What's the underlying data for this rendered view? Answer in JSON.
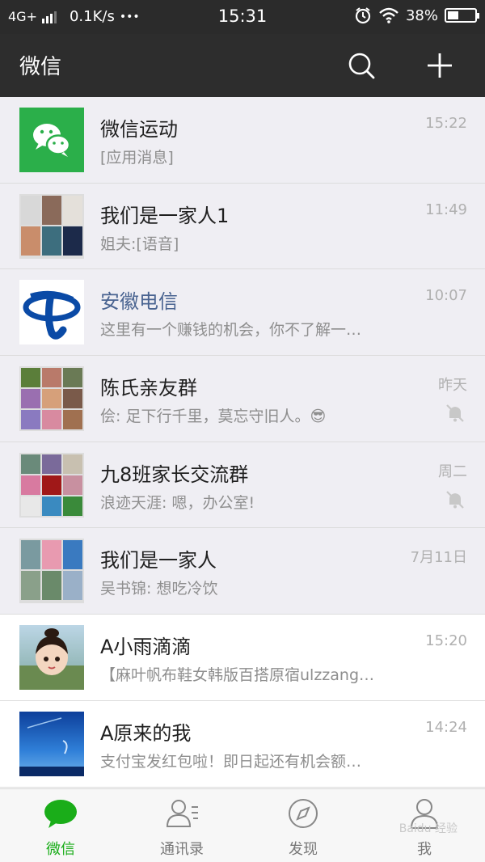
{
  "status_bar": {
    "network": "4G+",
    "speed": "0.1K/s",
    "more": "•••",
    "time": "15:31",
    "battery": "38%"
  },
  "header": {
    "title": "微信",
    "search_icon": "search-icon",
    "add_icon": "plus-icon"
  },
  "chats": [
    {
      "name": "微信运动",
      "message": "[应用消息]",
      "time": "15:22",
      "pinned": true,
      "muted": false,
      "avatar": "wechat-sport"
    },
    {
      "name": "我们是一家人1",
      "message": "姐夫:[语音]",
      "time": "11:49",
      "pinned": true,
      "muted": false,
      "avatar": "group"
    },
    {
      "name": "安徽电信",
      "message": "这里有一个赚钱的机会，你不了解一…",
      "time": "10:07",
      "pinned": true,
      "muted": false,
      "avatar": "telecom"
    },
    {
      "name": "陈氏亲友群",
      "message": "侩: 足下行千里，莫忘守旧人。😎",
      "time": "昨天",
      "pinned": true,
      "muted": true,
      "avatar": "group"
    },
    {
      "name": "九8班家长交流群",
      "message": "浪迹天涯: 嗯，办公室!",
      "time": "周二",
      "pinned": true,
      "muted": true,
      "avatar": "group"
    },
    {
      "name": "我们是一家人",
      "message": "吴书锦: 想吃冷饮",
      "time": "7月11日",
      "pinned": true,
      "muted": false,
      "avatar": "group"
    },
    {
      "name": "A小雨滴滴",
      "message": "【麻叶帆布鞋女韩版百搭原宿ulzzang…",
      "time": "15:20",
      "pinned": false,
      "muted": false,
      "avatar": "cartoon"
    },
    {
      "name": "A原来的我",
      "message": "支付宝发红包啦！即日起还有机会额…",
      "time": "14:24",
      "pinned": false,
      "muted": false,
      "avatar": "sky"
    }
  ],
  "tabs": [
    {
      "label": "微信",
      "icon": "chat-bubble-icon",
      "active": true
    },
    {
      "label": "通讯录",
      "icon": "contacts-icon",
      "active": false
    },
    {
      "label": "发现",
      "icon": "compass-icon",
      "active": false
    },
    {
      "label": "我",
      "icon": "person-icon",
      "active": false
    }
  ],
  "watermark": "Baidu 经验",
  "colors": {
    "accent": "#1aad19",
    "header_bg": "#2d2d2d",
    "pinned_bg": "#efeef3"
  }
}
